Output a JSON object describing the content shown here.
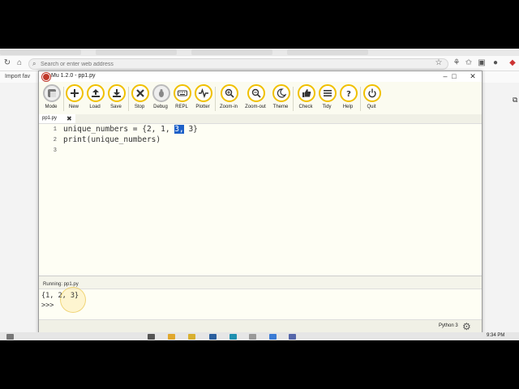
{
  "browser": {
    "address_placeholder": "Search or enter web address",
    "bookmark": "Import fav"
  },
  "window": {
    "title": "Mu 1.2.0 - pp1.py",
    "minimize": "–",
    "maximize": "□",
    "close": "✕"
  },
  "toolbar": {
    "buttons": [
      {
        "label": "Mode"
      },
      {
        "label": "New"
      },
      {
        "label": "Load"
      },
      {
        "label": "Save"
      },
      {
        "label": "Stop"
      },
      {
        "label": "Debug"
      },
      {
        "label": "REPL"
      },
      {
        "label": "Plotter"
      },
      {
        "label": "Zoom-in"
      },
      {
        "label": "Zoom-out"
      },
      {
        "label": "Theme"
      },
      {
        "label": "Check"
      },
      {
        "label": "Tidy"
      },
      {
        "label": "Help"
      },
      {
        "label": "Quit"
      }
    ]
  },
  "tab": {
    "filename": "pp1.py",
    "close": "✖"
  },
  "editor": {
    "line_numbers": [
      "1",
      "2",
      "3"
    ],
    "line1_pre": "unique_numbers = {2, 1, ",
    "line1_sel": "3,",
    "line1_post": " 3}",
    "line2": "print(unique_numbers)"
  },
  "repl": {
    "header": "Running: pp1.py",
    "output": "{1, 2, 3}",
    "prompt": ">>>"
  },
  "status": {
    "mode": "Python 3"
  },
  "taskbar": {
    "clock": "9:34 PM"
  },
  "colors": {
    "accent": "#f0c000",
    "selection": "#1d60c8",
    "editor_bg": "#fefef4"
  }
}
